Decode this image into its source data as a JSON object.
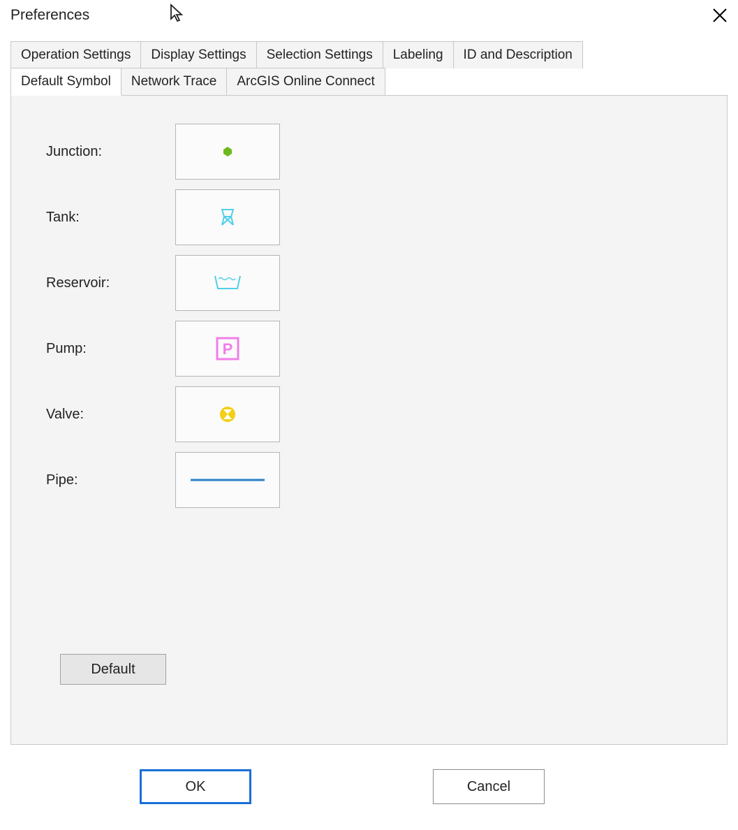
{
  "window": {
    "title": "Preferences"
  },
  "tabs_row1": [
    {
      "label": "Operation Settings"
    },
    {
      "label": "Display Settings"
    },
    {
      "label": "Selection Settings"
    },
    {
      "label": "Labeling"
    },
    {
      "label": "ID and Description"
    }
  ],
  "tabs_row2": [
    {
      "label": "Default Symbol",
      "active": true
    },
    {
      "label": "Network Trace"
    },
    {
      "label": "ArcGIS Online Connect"
    }
  ],
  "symbols": {
    "junction": {
      "label": "Junction:",
      "color": "#6db81e"
    },
    "tank": {
      "label": "Tank:",
      "color": "#4fd0e8"
    },
    "reservoir": {
      "label": "Reservoir:",
      "color": "#4fd0e8"
    },
    "pump": {
      "label": "Pump:",
      "color": "#f07fe8",
      "letter": "P"
    },
    "valve": {
      "label": "Valve:",
      "color": "#f3cf15"
    },
    "pipe": {
      "label": "Pipe:",
      "color": "#2a7fc9"
    }
  },
  "buttons": {
    "default": "Default",
    "ok": "OK",
    "cancel": "Cancel"
  }
}
